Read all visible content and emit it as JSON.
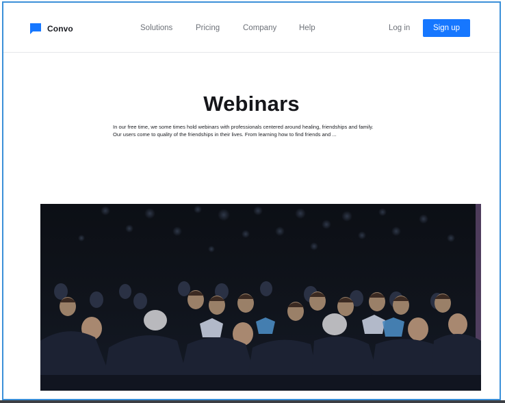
{
  "brand": {
    "name": "Convo",
    "logo_icon": "chat-bubble-icon",
    "accent": "#1677ff"
  },
  "nav": {
    "items": [
      {
        "label": "Solutions"
      },
      {
        "label": "Pricing"
      },
      {
        "label": "Company"
      },
      {
        "label": "Help"
      }
    ]
  },
  "auth": {
    "login_label": "Log in",
    "signup_label": "Sign up"
  },
  "hero": {
    "title": "Webinars",
    "description": "In our free time, we some times hold webinars with professionals centered around healing, friendships and family. Our users come to quality of the friendships in their lives. From learning how to find friends and ..."
  }
}
